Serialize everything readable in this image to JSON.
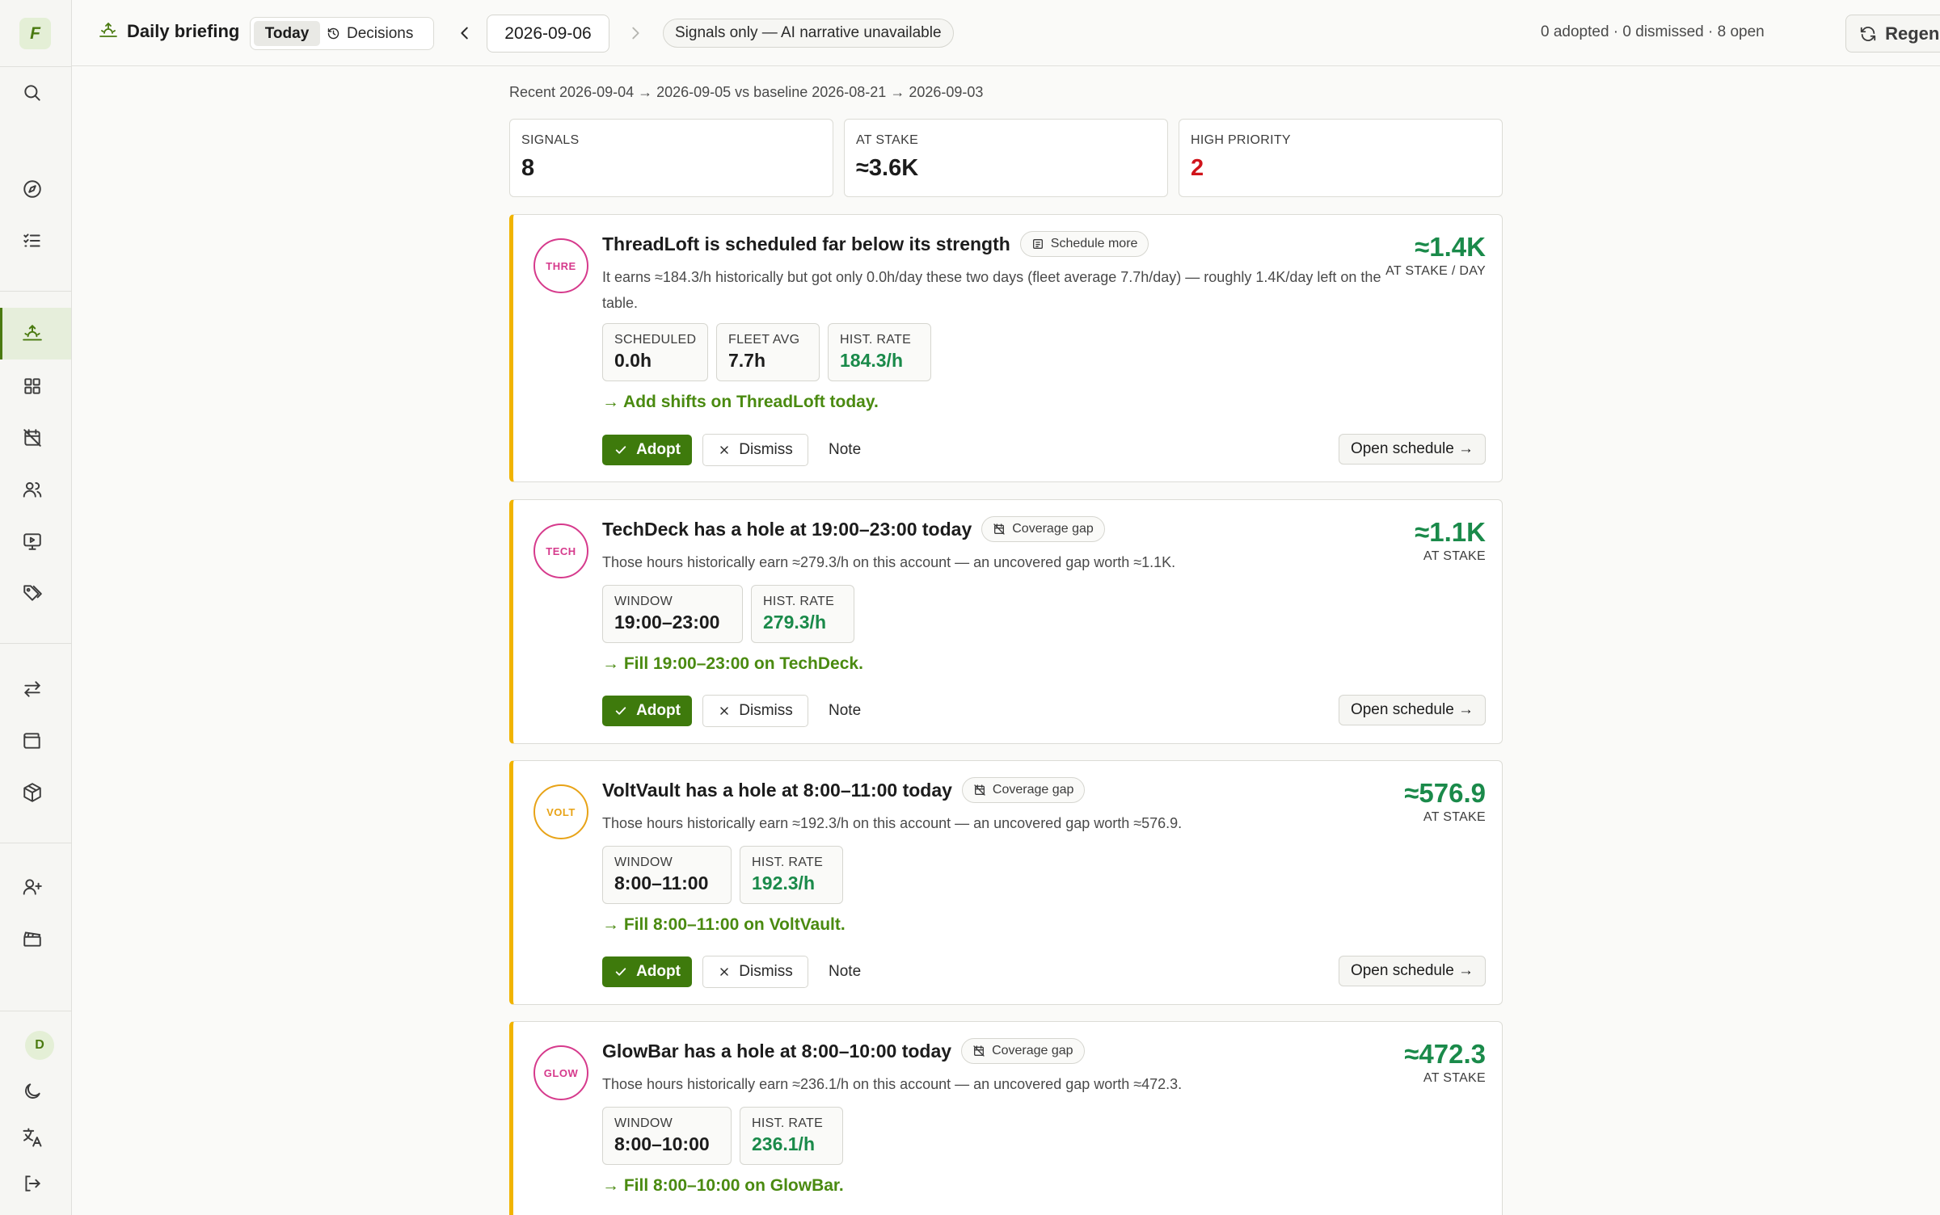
{
  "sidebar": {
    "logo": "F",
    "avatar_initial": "D"
  },
  "header": {
    "title": "Daily briefing",
    "tab_today": "Today",
    "tab_decisions": "Decisions",
    "date": "2026-09-06",
    "signals_chip": "Signals only — AI narrative unavailable",
    "counts": "0 adopted · 0 dismissed · 8 open",
    "regenerate": "Regenerate"
  },
  "range": "Recent 2026-09-04 → 2026-09-05 vs baseline 2026-08-21 → 2026-09-03",
  "stats": [
    {
      "label": "SIGNALS",
      "value": "8"
    },
    {
      "label": "AT STAKE",
      "value": "≈3.6K"
    },
    {
      "label": "HIGH PRIORITY",
      "value": "2"
    }
  ],
  "colors": {
    "accent": "#3e7a0c",
    "stake_green": "#1a8a4a",
    "priority_red": "#d0141b",
    "card_border": "#f1b400"
  },
  "cards": [
    {
      "avatar": "THRE",
      "avatar_color": "#d63a8c",
      "title": "ThreadLoft is scheduled far below its strength",
      "tag": "Schedule more",
      "description": "It earns ≈184.3/h historically but got only 0.0h/day these two days (fleet average 7.7h/day) — roughly 1.4K/day left on the table.",
      "amount": "≈1.4K",
      "amount_label": "AT STAKE / DAY",
      "metrics": [
        {
          "label": "SCHEDULED",
          "value": "0.0h"
        },
        {
          "label": "FLEET AVG",
          "value": "7.7h"
        },
        {
          "label": "HIST. RATE",
          "value": "184.3/h"
        }
      ],
      "action": "→ Add shifts on ThreadLoft today.",
      "adopt": "Adopt",
      "dismiss": "Dismiss",
      "note": "Note",
      "open": "Open schedule →"
    },
    {
      "avatar": "TECH",
      "avatar_color": "#d63a8c",
      "title": "TechDeck has a hole at 19:00–23:00 today",
      "tag": "Coverage gap",
      "description": "Those hours historically earn ≈279.3/h on this account — an uncovered gap worth ≈1.1K.",
      "amount": "≈1.1K",
      "amount_label": "AT STAKE",
      "metrics": [
        {
          "label": "WINDOW",
          "value": "19:00–23:00"
        },
        {
          "label": "HIST. RATE",
          "value": "279.3/h"
        }
      ],
      "action": "→ Fill 19:00–23:00 on TechDeck.",
      "adopt": "Adopt",
      "dismiss": "Dismiss",
      "note": "Note",
      "open": "Open schedule →"
    },
    {
      "avatar": "VOLT",
      "avatar_color": "#e8a317",
      "title": "VoltVault has a hole at 8:00–11:00 today",
      "tag": "Coverage gap",
      "description": "Those hours historically earn ≈192.3/h on this account — an uncovered gap worth ≈576.9.",
      "amount": "≈576.9",
      "amount_label": "AT STAKE",
      "metrics": [
        {
          "label": "WINDOW",
          "value": "8:00–11:00"
        },
        {
          "label": "HIST. RATE",
          "value": "192.3/h"
        }
      ],
      "action": "→ Fill 8:00–11:00 on VoltVault.",
      "adopt": "Adopt",
      "dismiss": "Dismiss",
      "note": "Note",
      "open": "Open schedule →"
    },
    {
      "avatar": "GLOW",
      "avatar_color": "#d63a8c",
      "title": "GlowBar has a hole at 8:00–10:00 today",
      "tag": "Coverage gap",
      "description": "Those hours historically earn ≈236.1/h on this account — an uncovered gap worth ≈472.3.",
      "amount": "≈472.3",
      "amount_label": "AT STAKE",
      "metrics": [
        {
          "label": "WINDOW",
          "value": "8:00–10:00"
        },
        {
          "label": "HIST. RATE",
          "value": "236.1/h"
        }
      ],
      "action": "→ Fill 8:00–10:00 on GlowBar."
    }
  ]
}
